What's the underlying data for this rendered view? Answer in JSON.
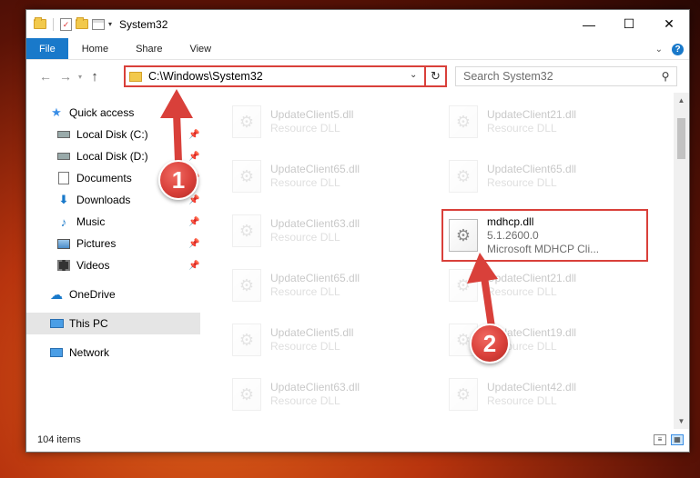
{
  "window": {
    "title": "System32",
    "minimize": "—",
    "maximize": "☐",
    "close": "✕"
  },
  "ribbon": {
    "tabs": [
      "File",
      "Home",
      "Share",
      "View"
    ],
    "help": "?"
  },
  "address": {
    "path": "C:\\Windows\\System32"
  },
  "search": {
    "placeholder": "Search System32"
  },
  "sidebar": {
    "items": [
      {
        "label": "Quick access",
        "icon": "star-icon"
      },
      {
        "label": "Local Disk (C:)",
        "icon": "drive-icon",
        "pinned": true
      },
      {
        "label": "Local Disk (D:)",
        "icon": "drive-icon",
        "pinned": true
      },
      {
        "label": "Documents",
        "icon": "documents-icon",
        "pinned": true
      },
      {
        "label": "Downloads",
        "icon": "download-icon",
        "pinned": true
      },
      {
        "label": "Music",
        "icon": "music-icon",
        "pinned": true
      },
      {
        "label": "Pictures",
        "icon": "pictures-icon",
        "pinned": true
      },
      {
        "label": "Videos",
        "icon": "videos-icon",
        "pinned": true
      },
      {
        "label": "OneDrive",
        "icon": "cloud-icon"
      },
      {
        "label": "This PC",
        "icon": "monitor-icon",
        "selected": true
      },
      {
        "label": "Network",
        "icon": "network-icon"
      }
    ]
  },
  "files": {
    "left": [
      {
        "name": "UpdateClient5.dll",
        "type": "Resource DLL"
      },
      {
        "name": "UpdateClient65.dll",
        "type": "Resource DLL"
      },
      {
        "name": "UpdateClient63.dll",
        "type": "Resource DLL"
      },
      {
        "name": "UpdateClient65.dll",
        "type": "Resource DLL"
      },
      {
        "name": "UpdateClient5.dll",
        "type": "Resource DLL"
      },
      {
        "name": "UpdateClient63.dll",
        "type": "Resource DLL"
      }
    ],
    "right": [
      {
        "name": "UpdateClient21.dll",
        "type": "Resource DLL"
      },
      {
        "name": "UpdateClient65.dll",
        "type": "Resource DLL"
      },
      {
        "name": "UpdateClient21.dll",
        "type": "Resource DLL"
      },
      {
        "name": "UpdateClient19.dll",
        "type": "Resource DLL"
      },
      {
        "name": "UpdateClient42.dll",
        "type": "Resource DLL"
      }
    ],
    "highlighted": {
      "name": "mdhcp.dll",
      "version": "5.1.2600.0",
      "description": "Microsoft MDHCP Cli..."
    }
  },
  "status": {
    "count": "104 items"
  },
  "annotations": {
    "step1": "1",
    "step2": "2",
    "color": "#d9403a"
  }
}
